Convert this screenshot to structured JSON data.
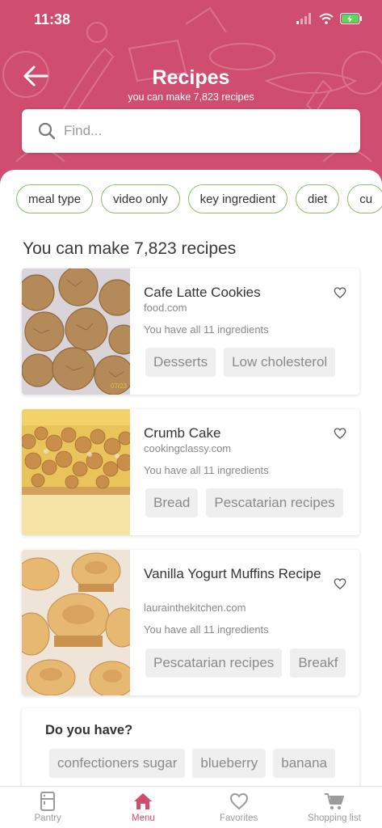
{
  "status": {
    "time": "11:38"
  },
  "header": {
    "title": "Recipes",
    "subtitle": "you can make 7,823 recipes"
  },
  "search": {
    "placeholder": "Find..."
  },
  "filters": [
    {
      "label": "meal type"
    },
    {
      "label": "video only"
    },
    {
      "label": "key ingredient"
    },
    {
      "label": "diet"
    },
    {
      "label": "cu"
    }
  ],
  "results": {
    "heading": "You can make 7,823 recipes"
  },
  "recipes": [
    {
      "title": "Cafe Latte Cookies",
      "source": "food.com",
      "ingredients_note": "You have all 11 ingredients",
      "tags": [
        "Desserts",
        "Low cholesterol"
      ],
      "image": "cookies-photo",
      "image_stamp": "07/23"
    },
    {
      "title": "Crumb Cake",
      "source": "cookingclassy.com",
      "ingredients_note": "You have all 11 ingredients",
      "tags": [
        "Bread",
        "Pescatarian recipes"
      ],
      "image": "crumb-cake-photo"
    },
    {
      "title": "Vanilla Yogurt Muffins Recipe",
      "source": "laurainthekitchen.com",
      "ingredients_note": "You have all 11 ingredients",
      "tags": [
        "Pescatarian recipes",
        "Breakf"
      ],
      "image": "muffins-photo"
    }
  ],
  "do_you_have": {
    "title": "Do you have?",
    "items": [
      "confectioners sugar",
      "blueberry",
      "banana"
    ]
  },
  "tabbar": [
    {
      "label": "Pantry",
      "icon": "fridge-icon"
    },
    {
      "label": "Menu",
      "icon": "home-icon",
      "active": true
    },
    {
      "label": "Favorites",
      "icon": "heart-icon"
    },
    {
      "label": "Shopping list",
      "icon": "cart-icon"
    }
  ],
  "colors": {
    "brand": "#cf4d6f",
    "chip_border": "#8ac06a",
    "tag_bg": "#efefef"
  }
}
